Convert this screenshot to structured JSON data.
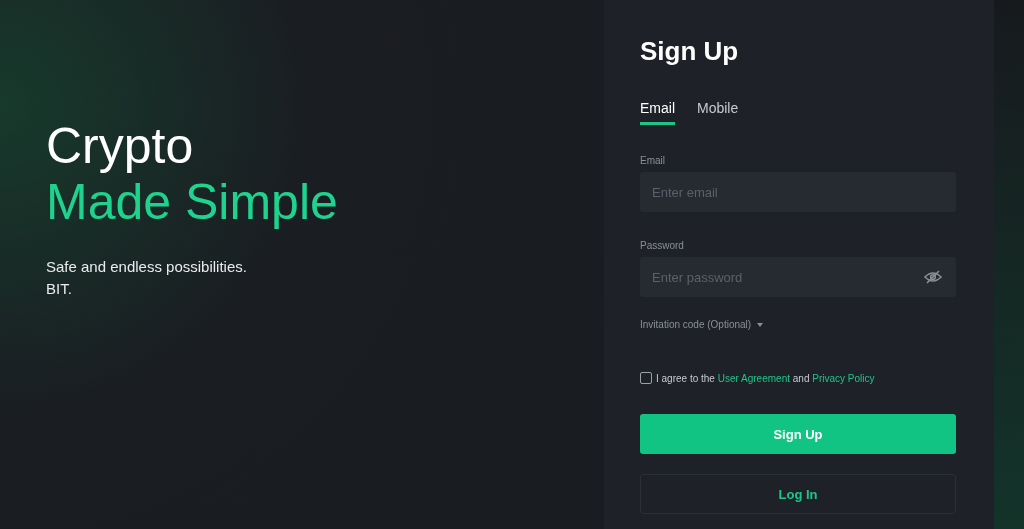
{
  "hero": {
    "title_line_1": "Crypto",
    "title_line_2": "Made Simple",
    "subtitle_line_1": "Safe and endless possibilities.",
    "subtitle_line_2": "BIT."
  },
  "form": {
    "title": "Sign Up",
    "tabs": [
      {
        "label": "Email",
        "selected": true
      },
      {
        "label": "Mobile",
        "selected": false
      }
    ],
    "fields": [
      {
        "label": "Email",
        "placeholder": "Enter email",
        "kind": "text"
      },
      {
        "label": "Password",
        "placeholder": "Enter password",
        "kind": "password"
      }
    ],
    "invitation": {
      "label": "Invitation code (Optional)",
      "expanded": false
    },
    "agreement": {
      "checked": false,
      "prefix": "I agree to the",
      "link_1": "User Agreement",
      "middle": "and",
      "link_2": "Privacy Policy"
    },
    "primary_button": "Sign Up",
    "secondary_button": "Log In"
  }
}
